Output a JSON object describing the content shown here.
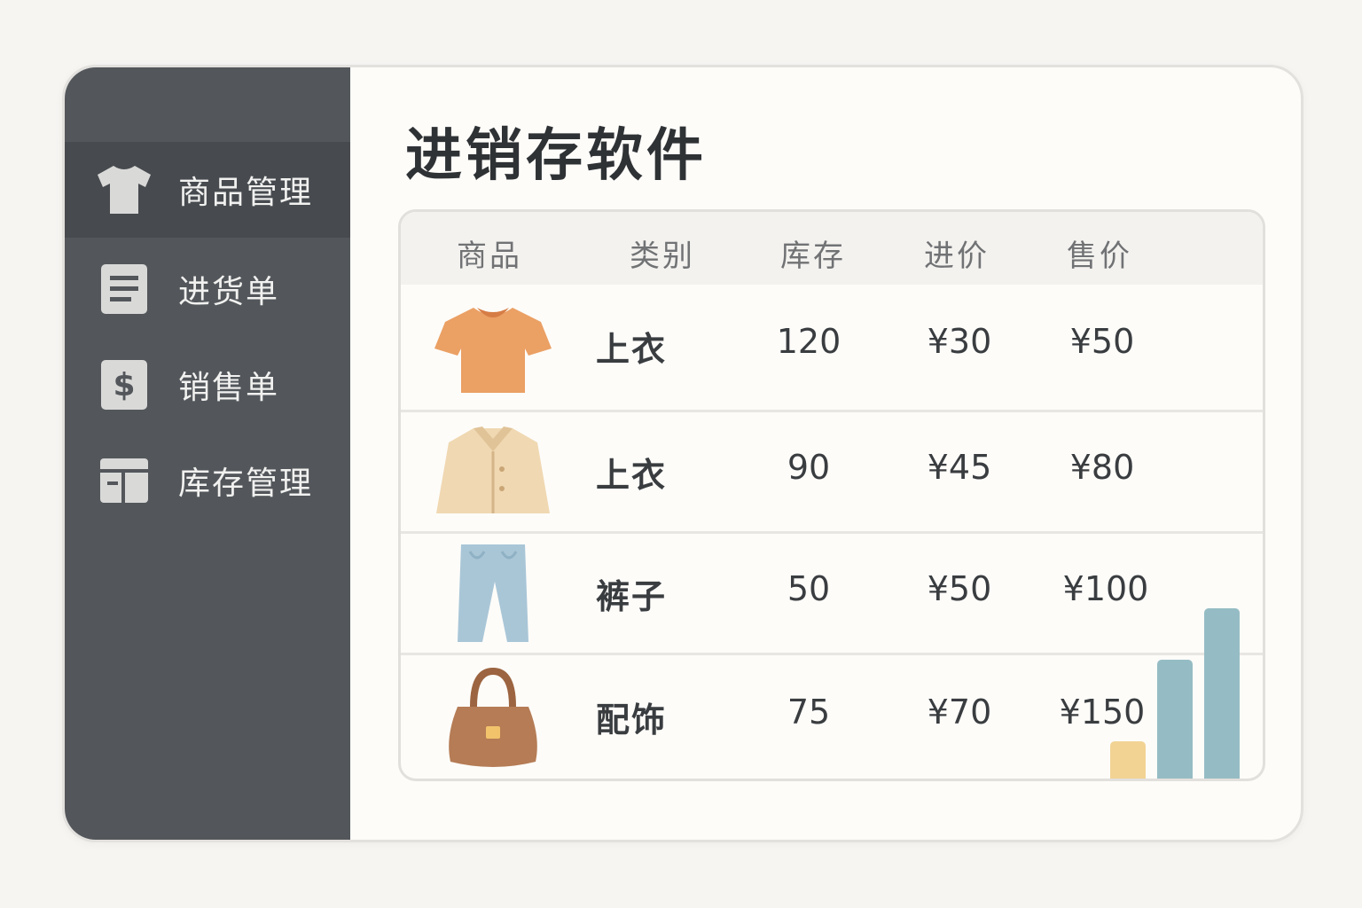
{
  "app": {
    "title": "进销存软件"
  },
  "sidebar": {
    "items": [
      {
        "label": "商品管理",
        "icon": "tshirt-icon",
        "active": true
      },
      {
        "label": "进货单",
        "icon": "document-icon",
        "active": false
      },
      {
        "label": "销售单",
        "icon": "dollar-icon",
        "active": false
      },
      {
        "label": "库存管理",
        "icon": "inventory-icon",
        "active": false
      }
    ]
  },
  "table": {
    "headers": [
      "商品",
      "类别",
      "库存",
      "进价",
      "售价"
    ],
    "rows": [
      {
        "image": "orange-tshirt-icon",
        "category": "上衣",
        "stock": "120",
        "cost": "¥30",
        "price": "¥50"
      },
      {
        "image": "beige-jacket-icon",
        "category": "上衣",
        "stock": "90",
        "cost": "¥45",
        "price": "¥80"
      },
      {
        "image": "blue-jeans-icon",
        "category": "裤子",
        "stock": "50",
        "cost": "¥50",
        "price": "¥100"
      },
      {
        "image": "brown-handbag-icon",
        "category": "配饰",
        "stock": "75",
        "cost": "¥70",
        "price": "¥150"
      }
    ]
  },
  "mini_chart": {
    "values": [
      0.22,
      0.7,
      1.0
    ],
    "colors": [
      "#f2d394",
      "#95bcc4",
      "#95bcc4"
    ]
  },
  "colors": {
    "sidebar": "#53575b",
    "sidebar_active": "#474b4f",
    "background": "#fdfcf9"
  }
}
